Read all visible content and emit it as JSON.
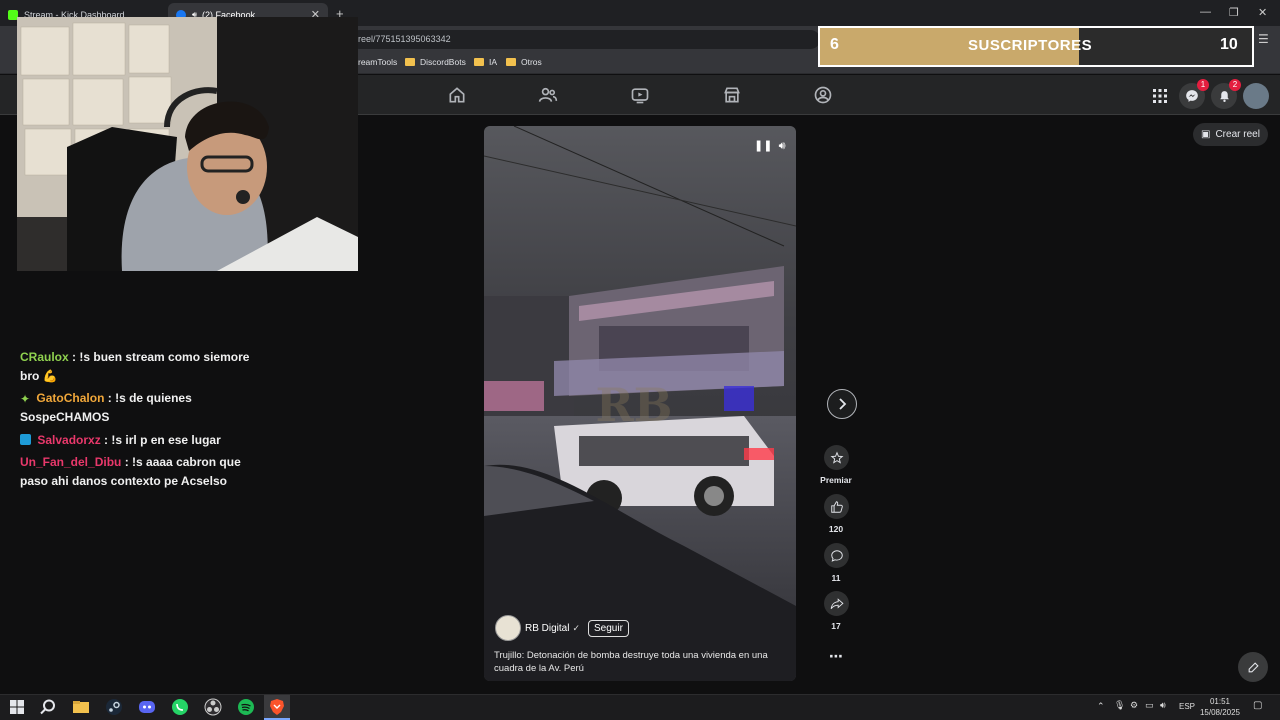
{
  "browser": {
    "tabs": [
      {
        "label": "Stream - Kick Dashboard",
        "favicon_color": "#53fc18"
      },
      {
        "label": "(2) Facebook",
        "favicon_color": "#1877f2"
      }
    ],
    "url": "reel/775151395063342",
    "bookmarks": [
      "reamTools",
      "DiscordBots",
      "IA",
      "Otros"
    ]
  },
  "overlay": {
    "left_count": "6",
    "label": "SUSCRIPTORES",
    "right_count": "10",
    "fill_fraction": 0.6
  },
  "facebook": {
    "notifications": {
      "messenger": "1",
      "bell": "2"
    },
    "create_reel": "Crear reel"
  },
  "chat": [
    {
      "user": "CRaulox",
      "user_color": "#8fd14f",
      "sep": " : ",
      "text": "!s buen stream como siemore bro 💪",
      "icon": ""
    },
    {
      "user": "GatoChalon",
      "user_color": "#f0a73a",
      "sep": " : ",
      "text": "!s de quienes SospeCHAMOS",
      "icon": "sparkle"
    },
    {
      "user": "Salvadorxz",
      "user_color": "#e9386b",
      "sep": " : ",
      "text": "!s irl p en ese lugar",
      "icon": "boost"
    },
    {
      "user": "Un_Fan_del_Dibu",
      "user_color": "#e9386b",
      "sep": " : ",
      "text": "!s aaaa cabron que paso ahi danos contexto pe Acselso",
      "icon": ""
    }
  ],
  "reel": {
    "author": "RB Digital",
    "follow": "Seguir",
    "caption": "Trujillo: Detonación de bomba destruye toda una vivienda en una cuadra de la Av. Perú",
    "actions": {
      "premiar": "Premiar",
      "likes": "120",
      "comments": "11",
      "shares": "17"
    }
  },
  "taskbar": {
    "lang": "ESP",
    "time": "01:51",
    "date": "15/08/2025"
  }
}
